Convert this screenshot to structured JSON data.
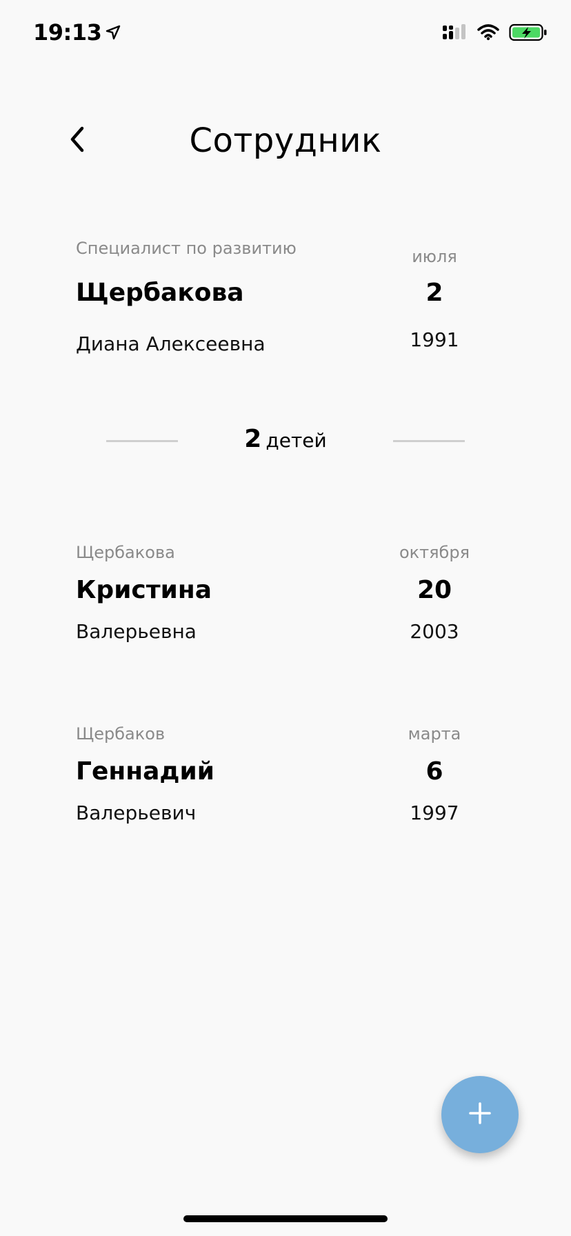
{
  "status_bar": {
    "time": "19:13",
    "location_icon": "location-arrow-icon",
    "signal_icon": "cellular-signal-icon",
    "wifi_icon": "wifi-icon",
    "battery_icon": "battery-charging-icon",
    "battery_color": "#4cd964"
  },
  "header": {
    "back_icon": "chevron-left-icon",
    "title": "Сотрудник"
  },
  "employee": {
    "position": "Специалист по развитию",
    "last_name": "Щербакова",
    "first_middle": "Диана Алексеевна",
    "birth_month": "июля",
    "birth_day": "2",
    "birth_year": "1991"
  },
  "children_summary": {
    "count": "2",
    "word": "детей"
  },
  "children": [
    {
      "last_name": "Щербакова",
      "first_name": "Кристина",
      "middle_name": "Валерьевна",
      "birth_month": "октября",
      "birth_day": "20",
      "birth_year": "2003"
    },
    {
      "last_name": "Щербаков",
      "first_name": "Геннадий",
      "middle_name": "Валерьевич",
      "birth_month": "марта",
      "birth_day": "6",
      "birth_year": "1997"
    }
  ],
  "fab": {
    "icon": "plus-icon",
    "color": "#77afdc"
  }
}
